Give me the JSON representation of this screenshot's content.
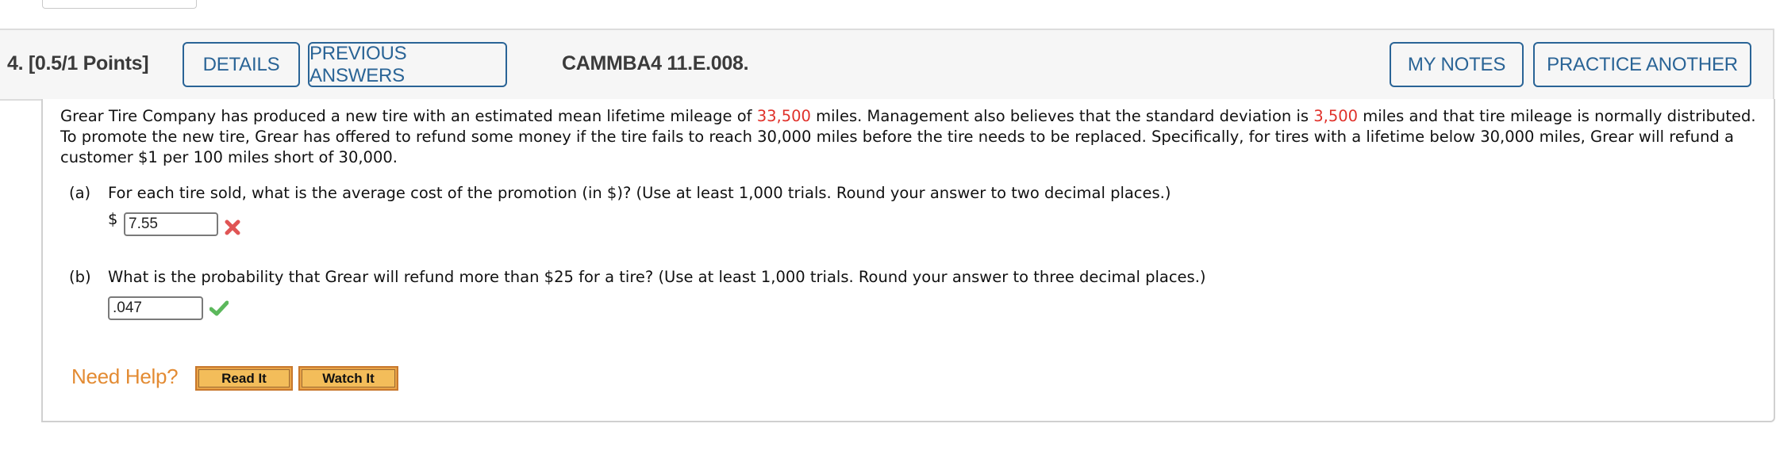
{
  "question": {
    "number_label": "4.  [0.5/1 Points]",
    "buttons": {
      "details": "DETAILS",
      "previous_answers": "PREVIOUS ANSWERS",
      "my_notes": "MY NOTES",
      "practice_another": "PRACTICE ANOTHER"
    },
    "code": "CAMMBA4 11.E.008."
  },
  "stem": {
    "part1": "Grear Tire Company has produced a new tire with an estimated mean lifetime mileage of ",
    "mean": "33,500",
    "part2": " miles. Management also believes that the standard deviation is ",
    "sd": "3,500",
    "part3": " miles and that tire mileage is normally distributed. To promote the new tire, Grear has offered to refund some money if the tire fails to reach 30,000 miles before the tire needs to be replaced. Specifically, for tires with a lifetime below 30,000 miles, Grear will refund a customer $1 per 100 miles short of 30,000."
  },
  "parts": [
    {
      "label": "(a)",
      "text": "For each tire sold, what is the average cost of the promotion (in $)? (Use at least 1,000 trials. Round your answer to two decimal places.)",
      "prefix": "$",
      "answer": "7.55",
      "status": "incorrect",
      "status_icon": "x-mark-icon"
    },
    {
      "label": "(b)",
      "text": "What is the probability that Grear will refund more than $25 for a tire? (Use at least 1,000 trials. Round your answer to three decimal places.)",
      "answer": ".047",
      "status": "correct",
      "status_icon": "check-mark-icon"
    }
  ],
  "help": {
    "label": "Need Help?",
    "read_it": "Read It",
    "watch_it": "Watch It"
  },
  "colors": {
    "accent": "#2a6496",
    "highlight": "#e0312a",
    "help": "#e38b33",
    "incorrect": "#e05555",
    "correct": "#5cb85c"
  }
}
